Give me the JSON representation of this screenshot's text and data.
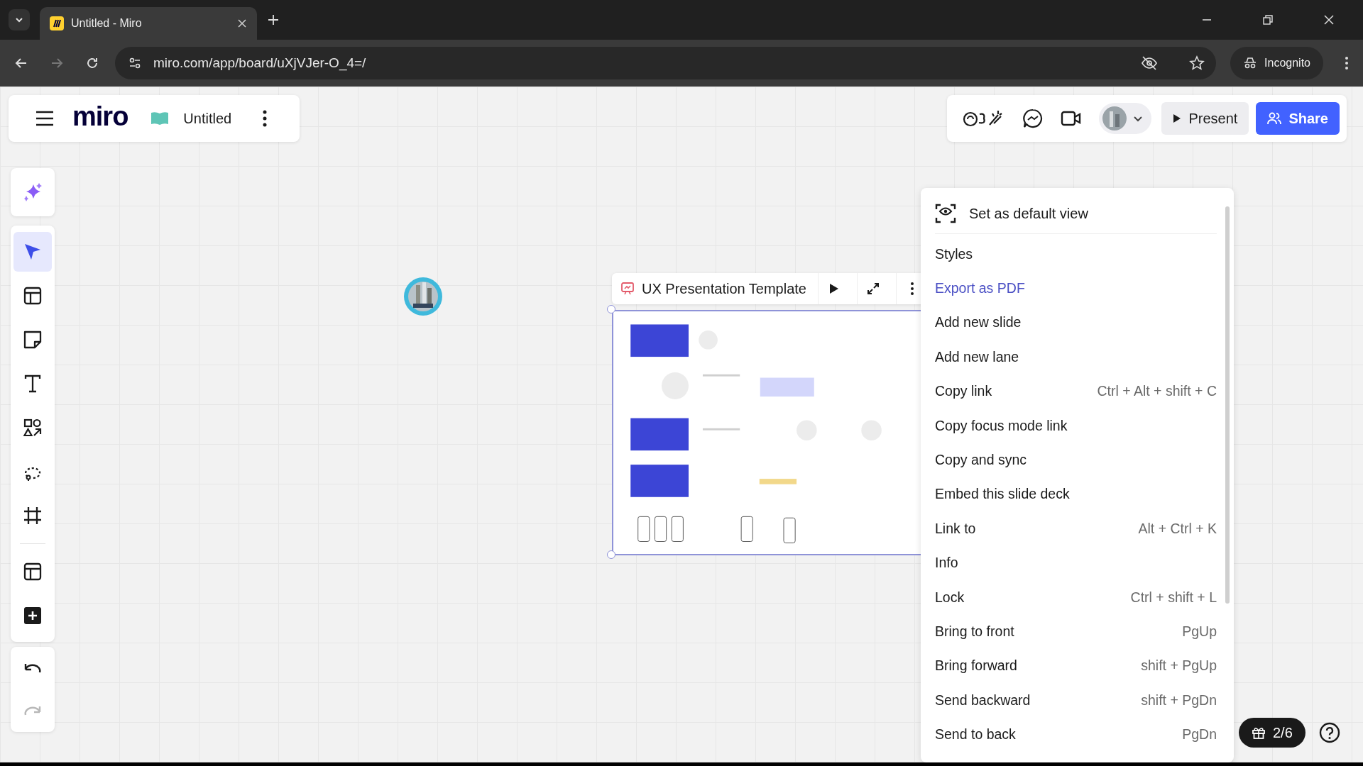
{
  "browser": {
    "tab": {
      "title": "Untitled - Miro"
    },
    "url": "miro.com/app/board/uXjVJer-O_4=/",
    "profile": "Incognito"
  },
  "board_header": {
    "logo": "miro",
    "board_name": "Untitled"
  },
  "top_actions": {
    "present": "Present",
    "share": "Share"
  },
  "tools": [
    {
      "kind": "select",
      "selected": true
    },
    {
      "kind": "templates",
      "selected": false
    },
    {
      "kind": "sticky",
      "selected": false
    },
    {
      "kind": "text",
      "selected": false
    },
    {
      "kind": "shapes",
      "selected": false
    },
    {
      "kind": "lasso",
      "selected": false
    },
    {
      "kind": "frame",
      "selected": false
    },
    {
      "kind": "table",
      "selected": false
    },
    {
      "kind": "more",
      "selected": false
    }
  ],
  "frame": {
    "title": "UX Presentation Template"
  },
  "context_menu": {
    "header": "Set as default view",
    "items": [
      {
        "label": "Styles",
        "hovered": false
      },
      {
        "label": "Export as PDF",
        "hovered": true
      },
      {
        "label": "Add new slide",
        "hovered": false
      },
      {
        "label": "Add new lane",
        "hovered": false
      },
      {
        "label": "Copy link",
        "shortcut": "Ctrl + Alt + shift + C",
        "hovered": false
      },
      {
        "label": "Copy focus mode link",
        "hovered": false
      },
      {
        "label": "Copy and sync",
        "hovered": false
      },
      {
        "label": "Embed this slide deck",
        "hovered": false
      },
      {
        "label": "Link to",
        "shortcut": "Alt + Ctrl + K",
        "hovered": false
      },
      {
        "label": "Info",
        "hovered": false
      },
      {
        "label": "Lock",
        "shortcut": "Ctrl + shift + L",
        "hovered": false
      },
      {
        "label": "Bring to front",
        "shortcut": "PgUp",
        "hovered": false
      },
      {
        "label": "Bring forward",
        "shortcut": "shift + PgUp",
        "hovered": false
      },
      {
        "label": "Send backward",
        "shortcut": "shift + PgDn",
        "hovered": false
      },
      {
        "label": "Send to back",
        "shortcut": "PgDn",
        "hovered": false
      }
    ]
  },
  "bottom": {
    "updates": "2/6"
  }
}
